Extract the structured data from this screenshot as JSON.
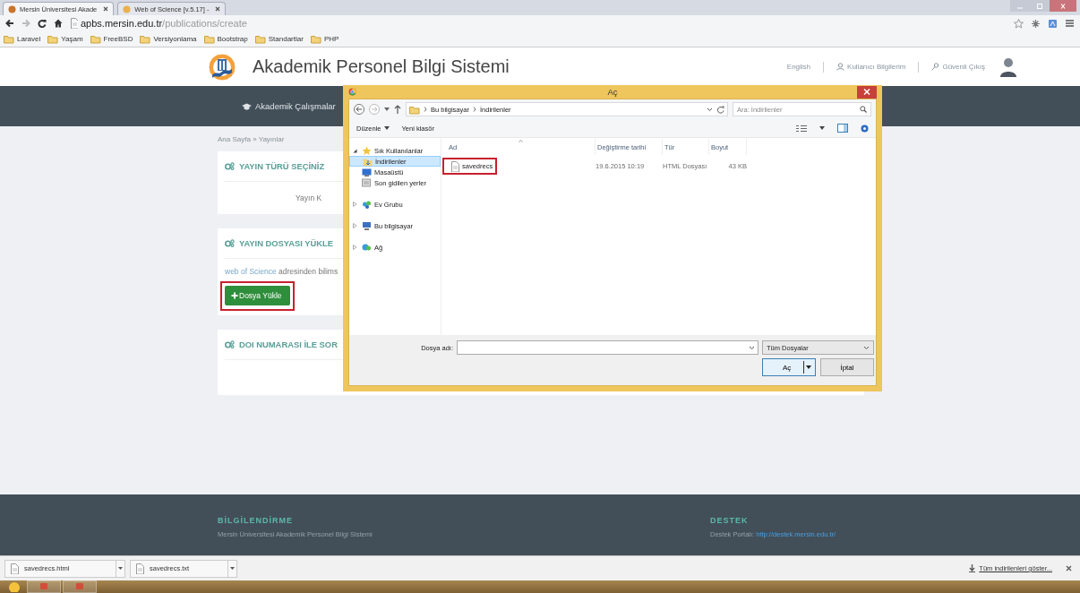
{
  "browser": {
    "tabs": [
      {
        "title": "Mersin Üniversitesi Akade",
        "selected": true
      },
      {
        "title": "Web of Science [v.5.17] - ",
        "selected": false
      }
    ],
    "address": {
      "host": "apbs.mersin.edu.tr",
      "path": "/publications/create"
    },
    "bookmarks": [
      "Laravel",
      "Yaşam",
      "FreeBSD",
      "Versiyonlama",
      "Bootstrap",
      "Standartlar",
      "PHP"
    ]
  },
  "header": {
    "title": "Akademik Personel Bilgi Sistemi",
    "links": [
      {
        "label": "English",
        "kind": "plain"
      },
      {
        "label": "Kullanıcı Bilgilerim",
        "kind": "profile"
      },
      {
        "label": "Güvenli Çıkış",
        "kind": "logout"
      }
    ]
  },
  "nav": [
    {
      "label": "Akademik Çalışmalar"
    }
  ],
  "breadcrumb": "Ana Sayfa » Yayınlar",
  "cards": [
    {
      "kind": "select",
      "title": "YAYIN TÜRÜ SEÇİNİZ",
      "text": "Yayın K"
    },
    {
      "kind": "upload",
      "title": "YAYIN DOSYASI YÜKLE",
      "link": "web of Science",
      "text": " adresinden bilims",
      "button": {
        "label": "Dosya Yükle",
        "highlighted": true
      }
    },
    {
      "kind": "doi",
      "title": "DOI NUMARASI İLE SOR"
    }
  ],
  "dialog": {
    "title": "Aç",
    "path": [
      "Bu bilgisayar",
      "İndirilenler"
    ],
    "search": {
      "placeholder": "Ara: İndirilenler"
    },
    "toolbar": [
      {
        "label": "Düzenle",
        "kind": "menu"
      },
      {
        "label": "Yeni klasör",
        "kind": "plain"
      }
    ],
    "tree": [
      {
        "label": "Sık Kullanılanlar",
        "kind": "favorites",
        "expanded": true,
        "selected": false,
        "children": [
          {
            "label": "İndirilenler",
            "kind": "downloads",
            "selected": true
          },
          {
            "label": "Masaüstü",
            "kind": "desktop",
            "selected": false
          },
          {
            "label": "Son gidilen yerler",
            "kind": "recent",
            "selected": false
          }
        ]
      },
      {
        "label": "Ev Grubu",
        "kind": "homegroup",
        "expanded": false,
        "selected": false
      },
      {
        "label": "Bu bilgisayar",
        "kind": "computer",
        "expanded": false,
        "selected": false
      },
      {
        "label": "Ağ",
        "kind": "network",
        "expanded": false,
        "selected": false
      }
    ],
    "columns": [
      "Ad",
      "Değiştirme tarihi",
      "Tür",
      "Boyut"
    ],
    "files": [
      {
        "name": "savedrecs",
        "modified": "19.6.2015 10:19",
        "type": "HTML Dosyası",
        "size": "43 KB",
        "highlighted": true,
        "selected": false
      }
    ],
    "filename_field": {
      "label": "Dosya adı:"
    },
    "filter": "Tüm Dosyalar",
    "buttons": [
      {
        "label": "Aç",
        "kind": "split"
      },
      {
        "label": "İptal",
        "kind": "plain"
      }
    ]
  },
  "footer": [
    {
      "title": "BİLGİLENDİRME",
      "text": "Mersin Üniversitesi Akademik Personel Bilgi Sistemi"
    },
    {
      "title": "DESTEK",
      "text": "Destek Portalı: ",
      "link": "http://destek.mersin.edu.tr/"
    }
  ],
  "downloads": {
    "items": [
      "savedrecs.html",
      "savedrecs.txt"
    ],
    "show_all": "Tüm indirilenleri göster..."
  }
}
